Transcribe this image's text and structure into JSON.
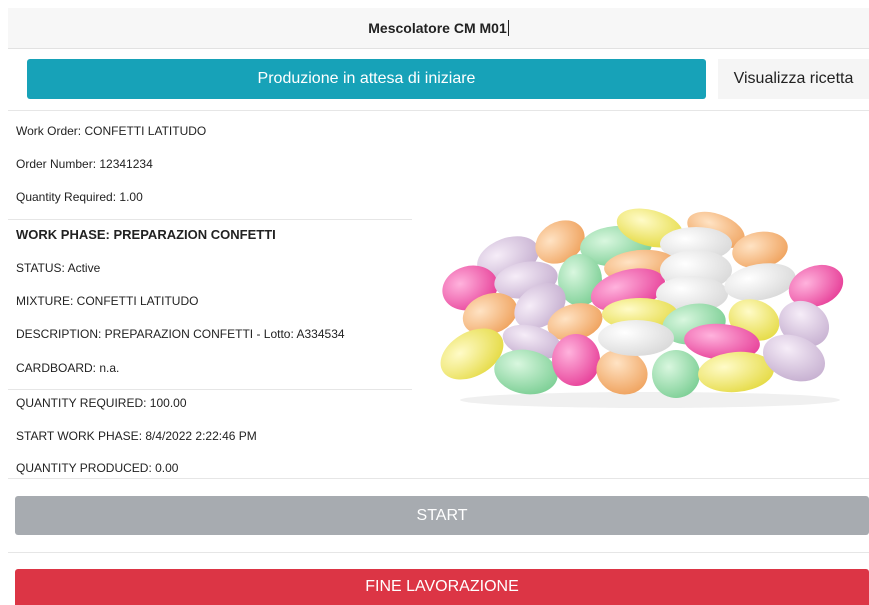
{
  "header": {
    "title": "Mescolatore CM M01"
  },
  "status_button": {
    "label": "Produzione in attesa di iniziare"
  },
  "recipe_button": {
    "label": "Visualizza ricetta"
  },
  "order": {
    "work_order": "Work Order: CONFETTI LATITUDO",
    "order_number": "Order Number: 12341234",
    "quantity_required": "Quantity Required: 1.00"
  },
  "phase": {
    "title": "WORK PHASE: PREPARAZION CONFETTI",
    "status": "STATUS: Active",
    "mixture": "MIXTURE: CONFETTI LATITUDO",
    "description": "DESCRIPTION: PREPARAZION CONFETTI - Lotto: A334534",
    "cardboard": "CARDBOARD: n.a.",
    "quantity_required": "QUANTITY REQUIRED: 100.00",
    "start_work_phase": "START WORK PHASE: 8/4/2022 2:22:46 PM",
    "quantity_produced": "QUANTITY PRODUCED: 0.00"
  },
  "actions": {
    "start_label": "START",
    "end_label": "FINE LAVORAZIONE"
  },
  "colors": {
    "status_accent": "#17a2b8",
    "start_disabled": "#a7abb0",
    "end_danger": "#dc3545"
  }
}
